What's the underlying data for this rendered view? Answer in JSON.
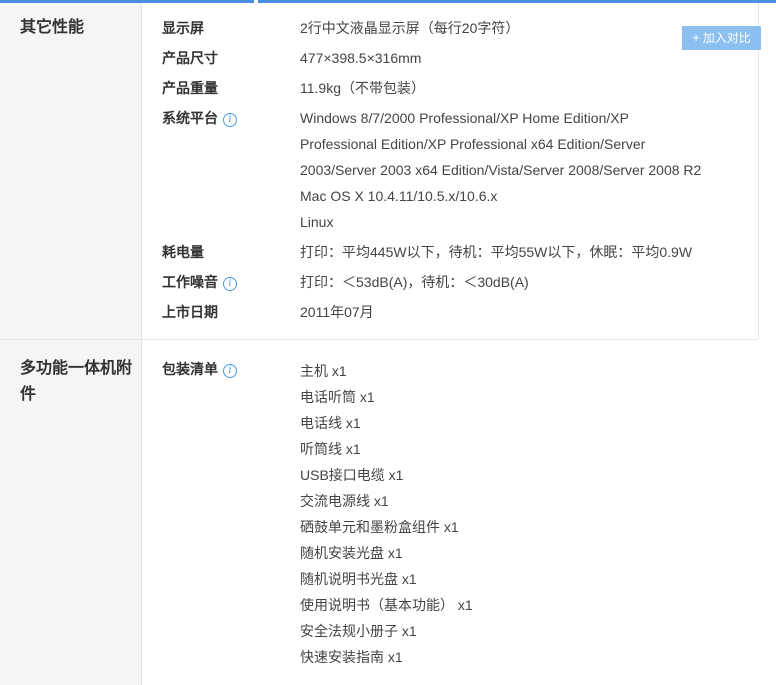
{
  "compare_button": {
    "icon": "+",
    "label": "加入对比"
  },
  "sections": [
    {
      "title": "其它性能",
      "rows": [
        {
          "label": "显示屏",
          "value": [
            "2行中文液晶显示屏（每行20字符）"
          ]
        },
        {
          "label": "产品尺寸",
          "value": [
            "477×398.5×316mm"
          ]
        },
        {
          "label": "产品重量",
          "value": [
            "11.9kg（不带包装）"
          ]
        },
        {
          "label": "系统平台",
          "info": true,
          "value": [
            "Windows 8/7/2000 Professional/XP Home Edition/XP",
            "Professional Edition/XP Professional x64 Edition/Server",
            "2003/Server 2003 x64 Edition/Vista/Server 2008/Server 2008 R2",
            "Mac OS X 10.4.11/10.5.x/10.6.x",
            "Linux"
          ]
        },
        {
          "label": "耗电量",
          "value": [
            "打印：平均445W以下，待机：平均55W以下，休眠：平均0.9W"
          ]
        },
        {
          "label": "工作噪音",
          "info": true,
          "value": [
            "打印：＜53dB(A)，待机：＜30dB(A)"
          ]
        },
        {
          "label": "上市日期",
          "value": [
            "2011年07月"
          ]
        }
      ]
    },
    {
      "title_lines": [
        "多功能一体机附",
        "件"
      ],
      "rows": [
        {
          "label": "包装清单",
          "info": true,
          "value": [
            "主机 x1",
            "电话听筒 x1",
            "电话线 x1",
            "听筒线 x1",
            "USB接口电缆 x1",
            "交流电源线 x1",
            "硒鼓单元和墨粉盒组件 x1",
            "随机安装光盘 x1",
            "随机说明书光盘 x1",
            "使用说明书（基本功能） x1",
            "安全法规小册子 x1",
            "快速安装指南 x1"
          ]
        }
      ]
    }
  ]
}
